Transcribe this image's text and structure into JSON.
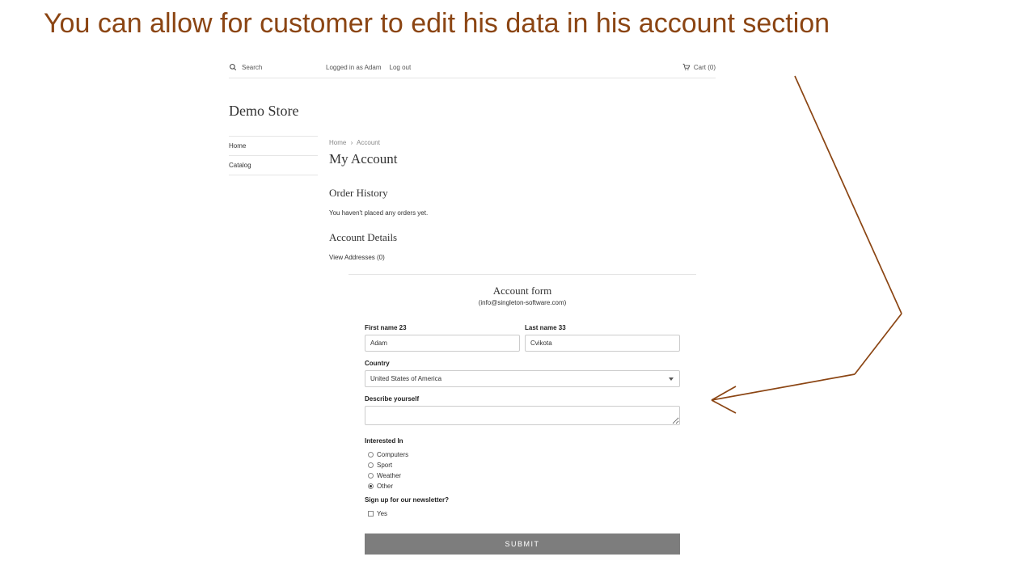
{
  "caption": "You can allow for customer to edit his data in his account section",
  "topbar": {
    "search_placeholder": "Search",
    "logged_in_as": "Logged in as Adam",
    "logout": "Log out",
    "cart_label": "Cart (0)"
  },
  "store_title": "Demo Store",
  "sidebar": {
    "items": [
      {
        "label": "Home"
      },
      {
        "label": "Catalog"
      }
    ]
  },
  "breadcrumb": {
    "home": "Home",
    "current": "Account"
  },
  "page_title": "My Account",
  "order_history": {
    "heading": "Order History",
    "empty_text": "You haven't placed any orders yet."
  },
  "account_details": {
    "heading": "Account Details",
    "view_addresses": "View Addresses (0)"
  },
  "form": {
    "title": "Account form",
    "subcaption": "(info@singleton-software.com)",
    "first_name_label": "First name 23",
    "first_name_value": "Adam",
    "last_name_label": "Last name 33",
    "last_name_value": "Cvikota",
    "country_label": "Country",
    "country_value": "United States of America",
    "describe_label": "Describe yourself",
    "describe_value": "",
    "interested_label": "Interested In",
    "interested_options": [
      {
        "label": "Computers",
        "selected": false
      },
      {
        "label": "Sport",
        "selected": false
      },
      {
        "label": "Weather",
        "selected": false
      },
      {
        "label": "Other",
        "selected": true
      }
    ],
    "newsletter_label": "Sign up for our newsletter?",
    "newsletter_option": "Yes",
    "submit_label": "SUBMIT"
  }
}
